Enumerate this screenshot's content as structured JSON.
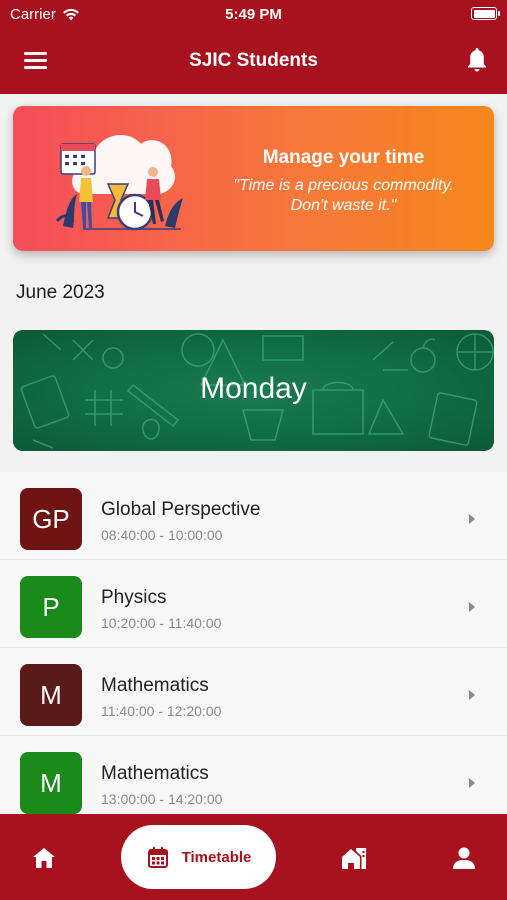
{
  "status": {
    "carrier": "Carrier",
    "time": "5:49 PM"
  },
  "app": {
    "title": "SJIC Students"
  },
  "banner": {
    "title": "Manage your time",
    "quote_line1": "\"Time is a precious commodity.",
    "quote_line2": "Don't waste it.\""
  },
  "month": "June 2023",
  "day": "Monday",
  "lessons": [
    {
      "initials": "GP",
      "title": "Global Perspective",
      "time": "08:40:00 - 10:00:00",
      "color": "#6e1414"
    },
    {
      "initials": "P",
      "title": "Physics",
      "time": "10:20:00 - 11:40:00",
      "color": "#1a8a1a"
    },
    {
      "initials": "M",
      "title": "Mathematics",
      "time": "11:40:00 - 12:20:00",
      "color": "#5a1a1a"
    },
    {
      "initials": "M",
      "title": "Mathematics",
      "time": "13:00:00 - 14:20:00",
      "color": "#1a8a1a"
    }
  ],
  "nav": {
    "active_label": "Timetable"
  },
  "colors": {
    "brand": "#a8121e",
    "banner_start": "#f54d5b",
    "banner_end": "#f6871d",
    "day_card": "#0f6a40"
  },
  "icons": [
    "wifi-icon",
    "battery-icon",
    "menu-icon",
    "bell-icon",
    "chevron-right-icon",
    "home-icon",
    "calendar-icon",
    "school-icon",
    "person-icon"
  ]
}
